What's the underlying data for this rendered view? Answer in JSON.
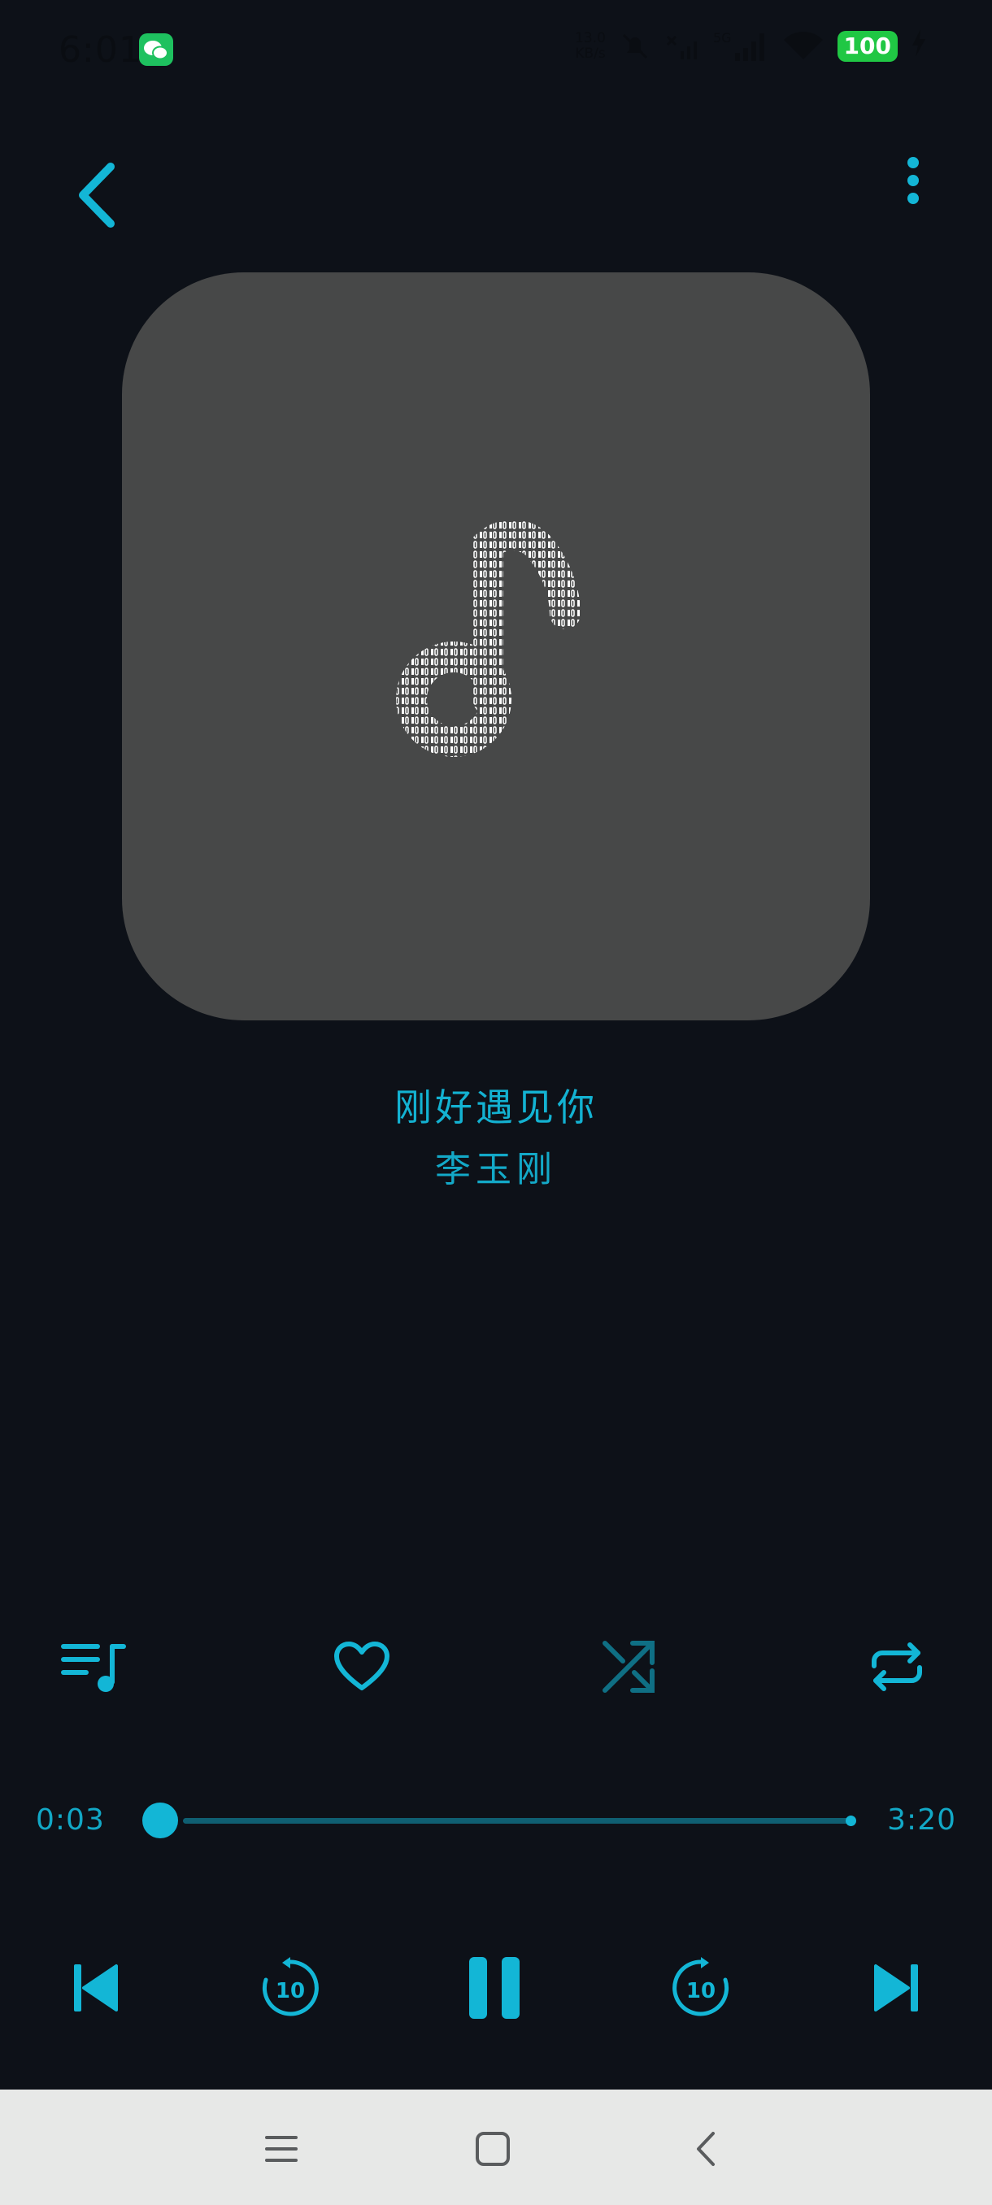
{
  "status_bar": {
    "time": "6:01",
    "net_speed_value": "13.0",
    "net_speed_unit": "KB/s",
    "network_type": "5G",
    "battery": "100"
  },
  "track": {
    "title": "刚好遇见你",
    "artist": "李玉刚"
  },
  "progress": {
    "current": "0:03",
    "total": "3:20",
    "fraction": 0.015
  },
  "icons": {
    "back": "back-icon",
    "more": "more-vertical-icon",
    "playlist": "playlist-icon",
    "favorite": "heart-icon",
    "shuffle": "shuffle-icon",
    "repeat": "repeat-icon",
    "previous": "skip-previous-icon",
    "rewind": "replay-10-icon",
    "pause": "pause-icon",
    "forward": "forward-10-icon",
    "next": "skip-next-icon"
  },
  "colors": {
    "background": "#0d1118",
    "accent": "#13b6d6",
    "artwork": "#474848",
    "nav_bar": "#e7e8e7"
  }
}
